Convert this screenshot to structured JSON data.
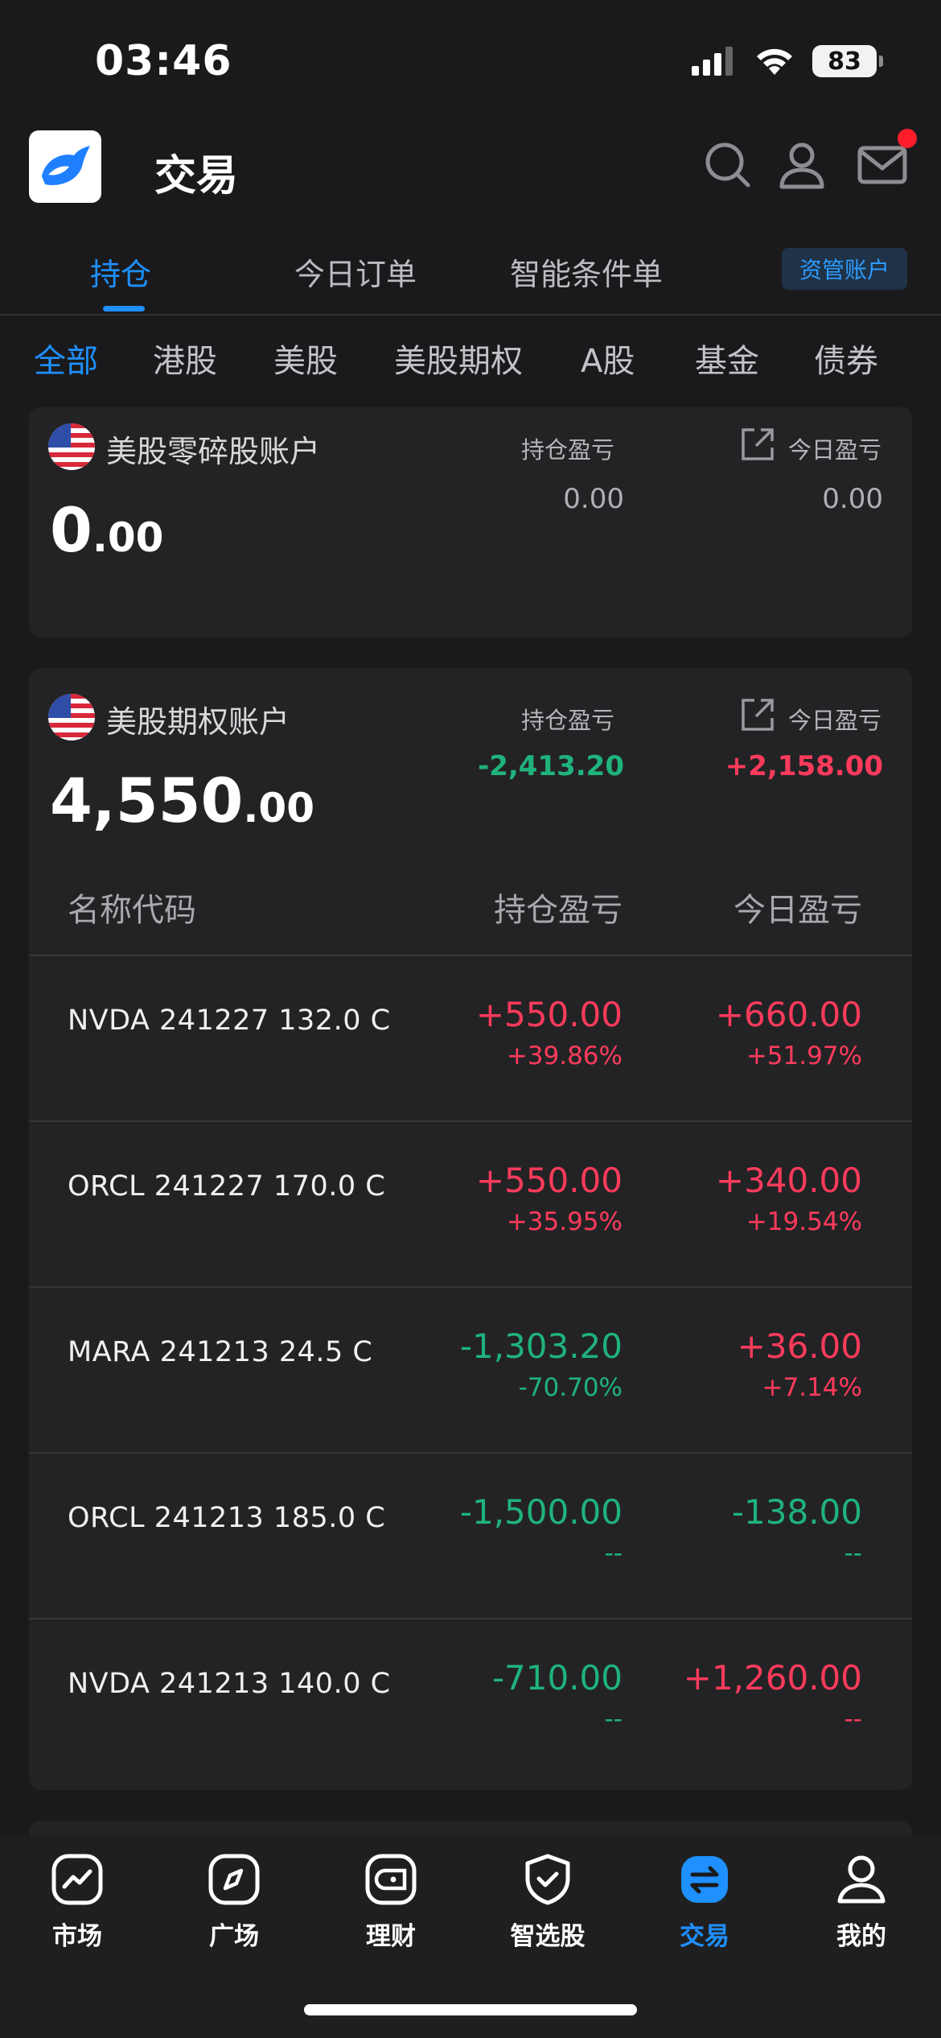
{
  "status": {
    "time": "03:46",
    "battery": "83"
  },
  "header": {
    "title": "交易"
  },
  "tabs": [
    {
      "label": "持仓"
    },
    {
      "label": "今日订单"
    },
    {
      "label": "智能条件单"
    }
  ],
  "asset_button": "资管账户",
  "filters": [
    "全部",
    "港股",
    "美股",
    "美股期权",
    "A股",
    "基金",
    "债券"
  ],
  "card1": {
    "name": "美股零碎股账户",
    "balance_int": "0",
    "balance_dec": ".00",
    "pos_label": "持仓盈亏",
    "pos_value": "0.00",
    "today_label": "今日盈亏",
    "today_value": "0.00"
  },
  "card2": {
    "name": "美股期权账户",
    "balance_int": "4,550",
    "balance_dec": ".00",
    "pos_label": "持仓盈亏",
    "pos_value": "-2,413.20",
    "today_label": "今日盈亏",
    "today_value": "+2,158.00",
    "columns": {
      "name": "名称代码",
      "pos": "持仓盈亏",
      "today": "今日盈亏"
    },
    "rows": [
      {
        "name": "NVDA 241227 132.0 C",
        "pos_amt": "+550.00",
        "pos_pct": "+39.86%",
        "today_amt": "+660.00",
        "today_pct": "+51.97%"
      },
      {
        "name": "ORCL 241227 170.0 C",
        "pos_amt": "+550.00",
        "pos_pct": "+35.95%",
        "today_amt": "+340.00",
        "today_pct": "+19.54%"
      },
      {
        "name": "MARA 241213 24.5 C",
        "pos_amt": "-1,303.20",
        "pos_pct": "-70.70%",
        "today_amt": "+36.00",
        "today_pct": "+7.14%"
      },
      {
        "name": "ORCL 241213 185.0 C",
        "pos_amt": "-1,500.00",
        "pos_pct": "--",
        "today_amt": "-138.00",
        "today_pct": "--"
      },
      {
        "name": "NVDA 241213 140.0 C",
        "pos_amt": "-710.00",
        "pos_pct": "--",
        "today_amt": "+1,260.00",
        "today_pct": "--"
      }
    ]
  },
  "bottom_nav": [
    {
      "label": "市场",
      "icon": "chart-icon"
    },
    {
      "label": "广场",
      "icon": "compass-icon"
    },
    {
      "label": "理财",
      "icon": "wallet-icon"
    },
    {
      "label": "智选股",
      "icon": "shield-check-icon"
    },
    {
      "label": "交易",
      "icon": "trade-icon"
    },
    {
      "label": "我的",
      "icon": "user-icon"
    }
  ],
  "colors": {
    "accent": "#1e90ff",
    "gain": "#ff3b5c",
    "loss": "#1fb37c"
  }
}
